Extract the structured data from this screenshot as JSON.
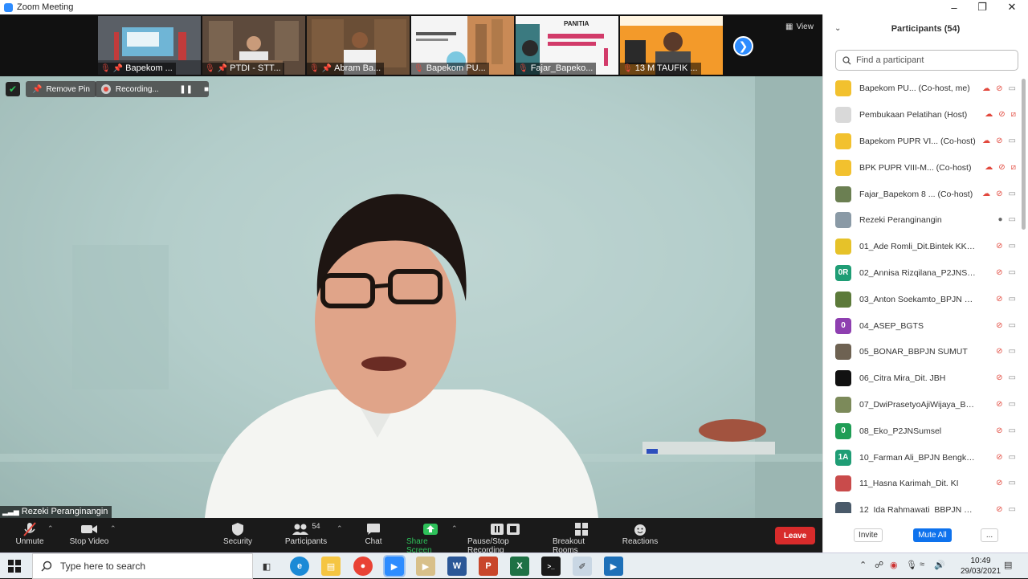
{
  "window": {
    "title": "Zoom Meeting"
  },
  "thumbnails": [
    {
      "name": "Bapekom ...",
      "pinned": true
    },
    {
      "name": "PTDI - STT...",
      "pinned": true
    },
    {
      "name": "Abram Ba...",
      "pinned": true
    },
    {
      "name": "Bapekom PU...",
      "pinned": false
    },
    {
      "name": "Fajar_Bapeko...",
      "pinned": false
    },
    {
      "name": "13 M TAUFIK ...",
      "pinned": false
    }
  ],
  "thumbnail_texts": {
    "panitia": "PANITIA"
  },
  "view_label": "View",
  "main": {
    "remove_pin_label": "Remove Pin",
    "recording_label": "Recording...",
    "speaker_name": "Rezeki Peranginangin"
  },
  "toolbar": {
    "unmute": "Unmute",
    "stop_video": "Stop Video",
    "security": "Security",
    "participants": "Participants",
    "participants_count": "54",
    "chat": "Chat",
    "share_screen": "Share Screen",
    "pause_stop_recording": "Pause/Stop Recording",
    "breakout_rooms": "Breakout Rooms",
    "reactions": "Reactions",
    "leave": "Leave"
  },
  "panel": {
    "title": "Participants (54)",
    "search_placeholder": "Find a participant",
    "participants": [
      {
        "name": "Bapekom PU... (Co-host, me)",
        "avatar": "",
        "avatar_color": "#f2c12e",
        "cc": true,
        "mic": "muted",
        "cam": "on"
      },
      {
        "name": "Pembukaan Pelatihan (Host)",
        "avatar": "",
        "avatar_color": "#d9d9d9",
        "cc": true,
        "mic": "muted",
        "cam": "off"
      },
      {
        "name": "Bapekom PUPR VI... (Co-host)",
        "avatar": "",
        "avatar_color": "#f2c12e",
        "cc": true,
        "mic": "muted",
        "cam": "on"
      },
      {
        "name": "BPK PUPR VIII-M... (Co-host)",
        "avatar": "",
        "avatar_color": "#f2c12e",
        "cc": true,
        "mic": "muted",
        "cam": "off"
      },
      {
        "name": "Fajar_Bapekom 8 ... (Co-host)",
        "avatar": "",
        "avatar_color": "#6b7f52",
        "cc": true,
        "mic": "muted",
        "cam": "on"
      },
      {
        "name": "Rezeki Peranginangin",
        "avatar": "",
        "avatar_color": "#8a9aa6",
        "cc": false,
        "mic": "on",
        "cam": "on"
      },
      {
        "name": "01_Ade Romli_Dit.Bintek KKJJ B...",
        "avatar": "",
        "avatar_color": "#e6c229",
        "cc": false,
        "mic": "muted",
        "cam": "on"
      },
      {
        "name": "02_Annisa Rizqilana_P2JNSumbar",
        "avatar": "0R",
        "avatar_color": "#1f9d75",
        "cc": false,
        "mic": "muted",
        "cam": "on"
      },
      {
        "name": "03_Anton Soekamto_BPJN NTB",
        "avatar": "",
        "avatar_color": "#5c7a3a",
        "cc": false,
        "mic": "muted",
        "cam": "on"
      },
      {
        "name": "04_ASEP_BGTS",
        "avatar": "0",
        "avatar_color": "#8e3fb0",
        "cc": false,
        "mic": "muted",
        "cam": "on"
      },
      {
        "name": "05_BONAR_BBPJN SUMUT",
        "avatar": "",
        "avatar_color": "#6e6252",
        "cc": false,
        "mic": "muted",
        "cam": "on"
      },
      {
        "name": "06_Citra Mira_Dit. JBH",
        "avatar": "",
        "avatar_color": "#111111",
        "cc": false,
        "mic": "muted",
        "cam": "on"
      },
      {
        "name": "07_DwiPrasetyoAjiWijaya_BBPJN...",
        "avatar": "",
        "avatar_color": "#7c8a5a",
        "cc": false,
        "mic": "muted",
        "cam": "on"
      },
      {
        "name": "08_Eko_P2JNSumsel",
        "avatar": "0",
        "avatar_color": "#1f9d55",
        "cc": false,
        "mic": "muted",
        "cam": "on"
      },
      {
        "name": "10_Farman Ali_BPJN Bengkulu",
        "avatar": "1A",
        "avatar_color": "#1f9d75",
        "cc": false,
        "mic": "muted",
        "cam": "on"
      },
      {
        "name": "11_Hasna Karimah_Dit. KI",
        "avatar": "",
        "avatar_color": "#c94b4b",
        "cc": false,
        "mic": "muted",
        "cam": "on"
      },
      {
        "name": "12_Ida Rahmawati_BBPJN Jateng...",
        "avatar": "",
        "avatar_color": "#4a5a6a",
        "cc": false,
        "mic": "muted",
        "cam": "on"
      }
    ],
    "invite_label": "Invite",
    "mute_all_label": "Mute All",
    "more_label": "..."
  },
  "taskbar": {
    "search_placeholder": "Type here to search",
    "time": "10:49",
    "date": "29/03/2021"
  }
}
